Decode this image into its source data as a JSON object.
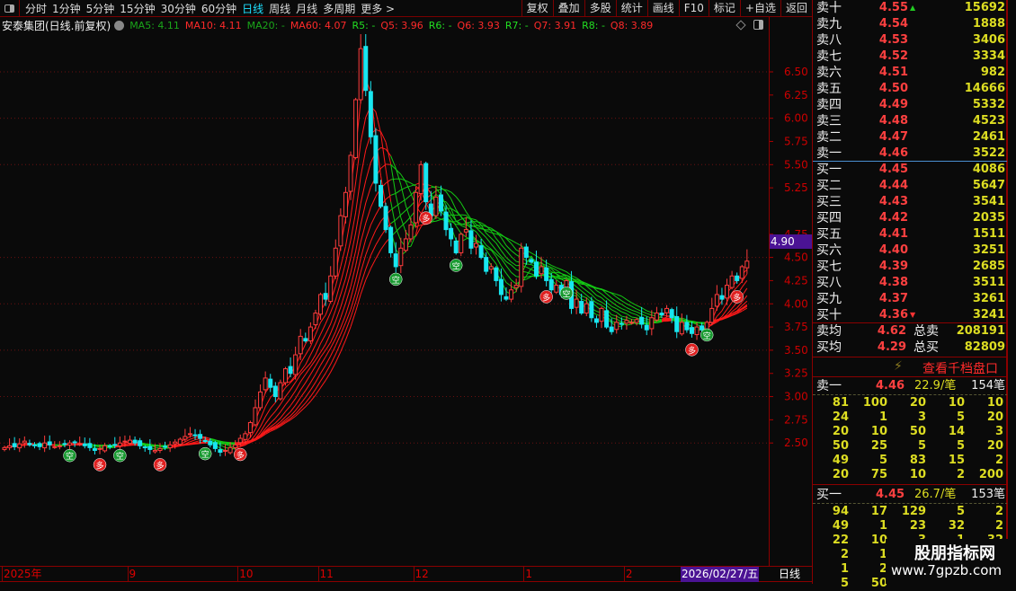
{
  "toolbar": {
    "periods": [
      "分时",
      "1分钟",
      "5分钟",
      "15分钟",
      "30分钟",
      "60分钟",
      "日线",
      "周线",
      "月线",
      "多周期",
      "更多 >"
    ],
    "active": "日线",
    "buttons": [
      "复权",
      "叠加",
      "多股",
      "统计",
      "画线",
      "F10",
      "标记",
      "+自选",
      "返回"
    ]
  },
  "legend": {
    "title": "安泰集团(日线.前复权)",
    "items": [
      {
        "text": "MA5: 4.11",
        "color": "g"
      },
      {
        "text": "MA10: 4.11",
        "color": "r"
      },
      {
        "text": "MA20: -",
        "color": "g"
      },
      {
        "text": "MA60: 4.07",
        "color": "r"
      },
      {
        "text": "R5: -",
        "color": "bg"
      },
      {
        "text": "Q5: 3.96",
        "color": "r"
      },
      {
        "text": "R6: -",
        "color": "bg"
      },
      {
        "text": "Q6: 3.93",
        "color": "r"
      },
      {
        "text": "R7: -",
        "color": "bg"
      },
      {
        "text": "Q7: 3.91",
        "color": "r"
      },
      {
        "text": "R8: -",
        "color": "bg"
      },
      {
        "text": "Q8: 3.89",
        "color": "r"
      }
    ]
  },
  "chart_data": {
    "type": "candlestick",
    "ylim": [
      2.2,
      7.0
    ],
    "y_ticks": [
      "6.50",
      "6.25",
      "6.00",
      "5.75",
      "5.50",
      "5.25",
      "4.75",
      "4.50",
      "4.25",
      "4.00",
      "3.75",
      "3.50",
      "3.25",
      "3.00",
      "2.75",
      "2.50"
    ],
    "closes": [
      2.45,
      2.47,
      2.46,
      2.49,
      2.52,
      2.48,
      2.47,
      2.46,
      2.5,
      2.48,
      2.46,
      2.47,
      2.49,
      2.5,
      2.51,
      2.49,
      2.47,
      2.45,
      2.42,
      2.44,
      2.47,
      2.46,
      2.48,
      2.5,
      2.52,
      2.53,
      2.5,
      2.47,
      2.45,
      2.43,
      2.42,
      2.44,
      2.46,
      2.48,
      2.51,
      2.54,
      2.57,
      2.6,
      2.58,
      2.55,
      2.52,
      2.48,
      2.44,
      2.4,
      2.42,
      2.45,
      2.48,
      2.55,
      2.6,
      2.72,
      2.88,
      3.05,
      3.2,
      3.1,
      3.0,
      3.15,
      3.3,
      3.25,
      3.45,
      3.65,
      3.6,
      3.75,
      3.9,
      4.1,
      4.05,
      4.3,
      4.6,
      4.95,
      5.2,
      5.6,
      6.2,
      6.75,
      6.3,
      5.8,
      5.3,
      5.05,
      4.8,
      4.55,
      4.4,
      4.6,
      4.7,
      4.85,
      5.2,
      5.5,
      5.1,
      4.95,
      5.15,
      5.0,
      4.8,
      4.7,
      4.55,
      4.75,
      4.8,
      4.6,
      4.65,
      4.5,
      4.35,
      4.4,
      4.25,
      4.1,
      4.05,
      4.15,
      4.2,
      4.6,
      4.5,
      4.45,
      4.3,
      4.4,
      4.25,
      4.15,
      4.2,
      4.1,
      4.25,
      3.95,
      4.05,
      3.9,
      4.0,
      3.85,
      3.8,
      3.95,
      3.75,
      3.7,
      3.8,
      3.78,
      3.82,
      3.8,
      3.83,
      3.78,
      3.72,
      3.85,
      3.9,
      3.88,
      3.95,
      3.85,
      3.7,
      3.8,
      3.72,
      3.68,
      3.75,
      3.72,
      3.8,
      3.95,
      4.1,
      4.05,
      4.2,
      4.3,
      4.25,
      4.4,
      4.46
    ],
    "signals": [
      {
        "i": 13,
        "label": "空"
      },
      {
        "i": 19,
        "label": "多"
      },
      {
        "i": 23,
        "label": "空"
      },
      {
        "i": 31,
        "label": "多"
      },
      {
        "i": 40,
        "label": "空"
      },
      {
        "i": 47,
        "label": "多"
      },
      {
        "i": 78,
        "label": "空"
      },
      {
        "i": 84,
        "label": "多"
      },
      {
        "i": 90,
        "label": "空"
      },
      {
        "i": 108,
        "label": "多"
      },
      {
        "i": 112,
        "label": "空"
      },
      {
        "i": 137,
        "label": "多"
      },
      {
        "i": 140,
        "label": "空"
      },
      {
        "i": 146,
        "label": "多"
      }
    ],
    "current_price": "4.90",
    "colors": {
      "up": "#ff3c3c",
      "down": "#18e6f0",
      "ribbon_up": "#ff1a1a",
      "ribbon_down": "#14c814"
    }
  },
  "xaxis": {
    "labels": [
      {
        "text": "2025年",
        "i": 0
      },
      {
        "text": "9",
        "i": 25
      },
      {
        "text": "10",
        "i": 47
      },
      {
        "text": "11",
        "i": 63
      },
      {
        "text": "12",
        "i": 82
      },
      {
        "text": "1",
        "i": 104
      },
      {
        "text": "2",
        "i": 124
      }
    ],
    "cursor": "2026/02/27/五",
    "period": "日线"
  },
  "orderbook": {
    "sells": [
      {
        "label": "卖十",
        "price": "4.55",
        "vol": "15692"
      },
      {
        "label": "卖九",
        "price": "4.54",
        "vol": "1888"
      },
      {
        "label": "卖八",
        "price": "4.53",
        "vol": "3406"
      },
      {
        "label": "卖七",
        "price": "4.52",
        "vol": "3334"
      },
      {
        "label": "卖六",
        "price": "4.51",
        "vol": "982"
      },
      {
        "label": "卖五",
        "price": "4.50",
        "vol": "14666"
      },
      {
        "label": "卖四",
        "price": "4.49",
        "vol": "5332"
      },
      {
        "label": "卖三",
        "price": "4.48",
        "vol": "4523"
      },
      {
        "label": "卖二",
        "price": "4.47",
        "vol": "2461"
      },
      {
        "label": "卖一",
        "price": "4.46",
        "vol": "3522"
      }
    ],
    "buys": [
      {
        "label": "买一",
        "price": "4.45",
        "vol": "4086"
      },
      {
        "label": "买二",
        "price": "4.44",
        "vol": "5647"
      },
      {
        "label": "买三",
        "price": "4.43",
        "vol": "3541"
      },
      {
        "label": "买四",
        "price": "4.42",
        "vol": "2035"
      },
      {
        "label": "买五",
        "price": "4.41",
        "vol": "1511"
      },
      {
        "label": "买六",
        "price": "4.40",
        "vol": "3251"
      },
      {
        "label": "买七",
        "price": "4.39",
        "vol": "2685"
      },
      {
        "label": "买八",
        "price": "4.38",
        "vol": "3511"
      },
      {
        "label": "买九",
        "price": "4.37",
        "vol": "3261"
      },
      {
        "label": "买十",
        "price": "4.36",
        "vol": "3241"
      }
    ],
    "avg": [
      {
        "label": "卖均",
        "price": "4.62",
        "tlabel": "总卖",
        "total": "208191"
      },
      {
        "label": "买均",
        "price": "4.29",
        "tlabel": "总买",
        "total": "82809"
      }
    ],
    "depth_link": "查看千档盘口",
    "sell1": {
      "label": "卖一",
      "price": "4.46",
      "per": "22.9/笔",
      "count": "154笔",
      "queue": [
        [
          "81",
          "100",
          "20",
          "10",
          "10"
        ],
        [
          "24",
          "1",
          "3",
          "5",
          "20"
        ],
        [
          "20",
          "10",
          "50",
          "14",
          "3"
        ],
        [
          "50",
          "25",
          "5",
          "5",
          "20"
        ],
        [
          "49",
          "5",
          "83",
          "15",
          "2"
        ],
        [
          "20",
          "75",
          "10",
          "2",
          "200"
        ]
      ]
    },
    "buy1": {
      "label": "买一",
      "price": "4.45",
      "per": "26.7/笔",
      "count": "153笔",
      "queue": [
        [
          "94",
          "17",
          "129",
          "5",
          "2"
        ],
        [
          "49",
          "1",
          "23",
          "32",
          "2"
        ],
        [
          "22",
          "10",
          "3",
          "1",
          "32"
        ],
        [
          "2",
          "1",
          "",
          "",
          ""
        ],
        [
          "1",
          "2",
          "",
          "",
          ""
        ],
        [
          "5",
          "50",
          "",
          "",
          ""
        ]
      ]
    }
  },
  "watermark": {
    "name": "股朋指标网",
    "url": "www.7gpzb.com"
  }
}
